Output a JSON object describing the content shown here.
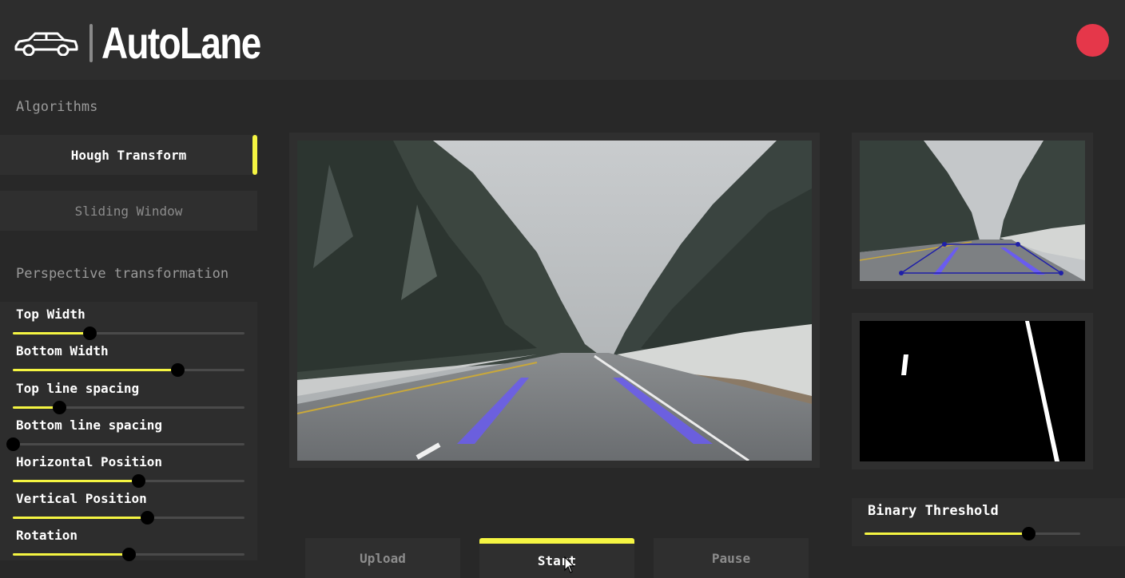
{
  "header": {
    "app_title": "AutoLane",
    "logo_icon": "car-icon",
    "status_indicator_color": "#e5374a"
  },
  "sidebar": {
    "algorithms_title": "Algorithms",
    "algorithms": [
      {
        "label": "Hough Transform",
        "active": true
      },
      {
        "label": "Sliding Window",
        "active": false
      }
    ],
    "perspective_title": "Perspective transformation",
    "sliders": [
      {
        "label": "Top Width",
        "value": 0.33
      },
      {
        "label": "Bottom Width",
        "value": 0.71
      },
      {
        "label": "Top line spacing",
        "value": 0.2
      },
      {
        "label": "Bottom line spacing",
        "value": 0.0
      },
      {
        "label": "Horizontal Position",
        "value": 0.54
      },
      {
        "label": "Vertical Position",
        "value": 0.58
      },
      {
        "label": "Rotation",
        "value": 0.5
      }
    ]
  },
  "threshold": {
    "label": "Binary Threshold",
    "value": 0.76
  },
  "controls": {
    "upload_label": "Upload",
    "start_label": "Start",
    "pause_label": "Pause",
    "active": "Start"
  },
  "colors": {
    "accent": "#f5f542",
    "lane_overlay": "#6a5cf0",
    "roi_outline": "#1f1fa8",
    "record": "#e5374a"
  }
}
